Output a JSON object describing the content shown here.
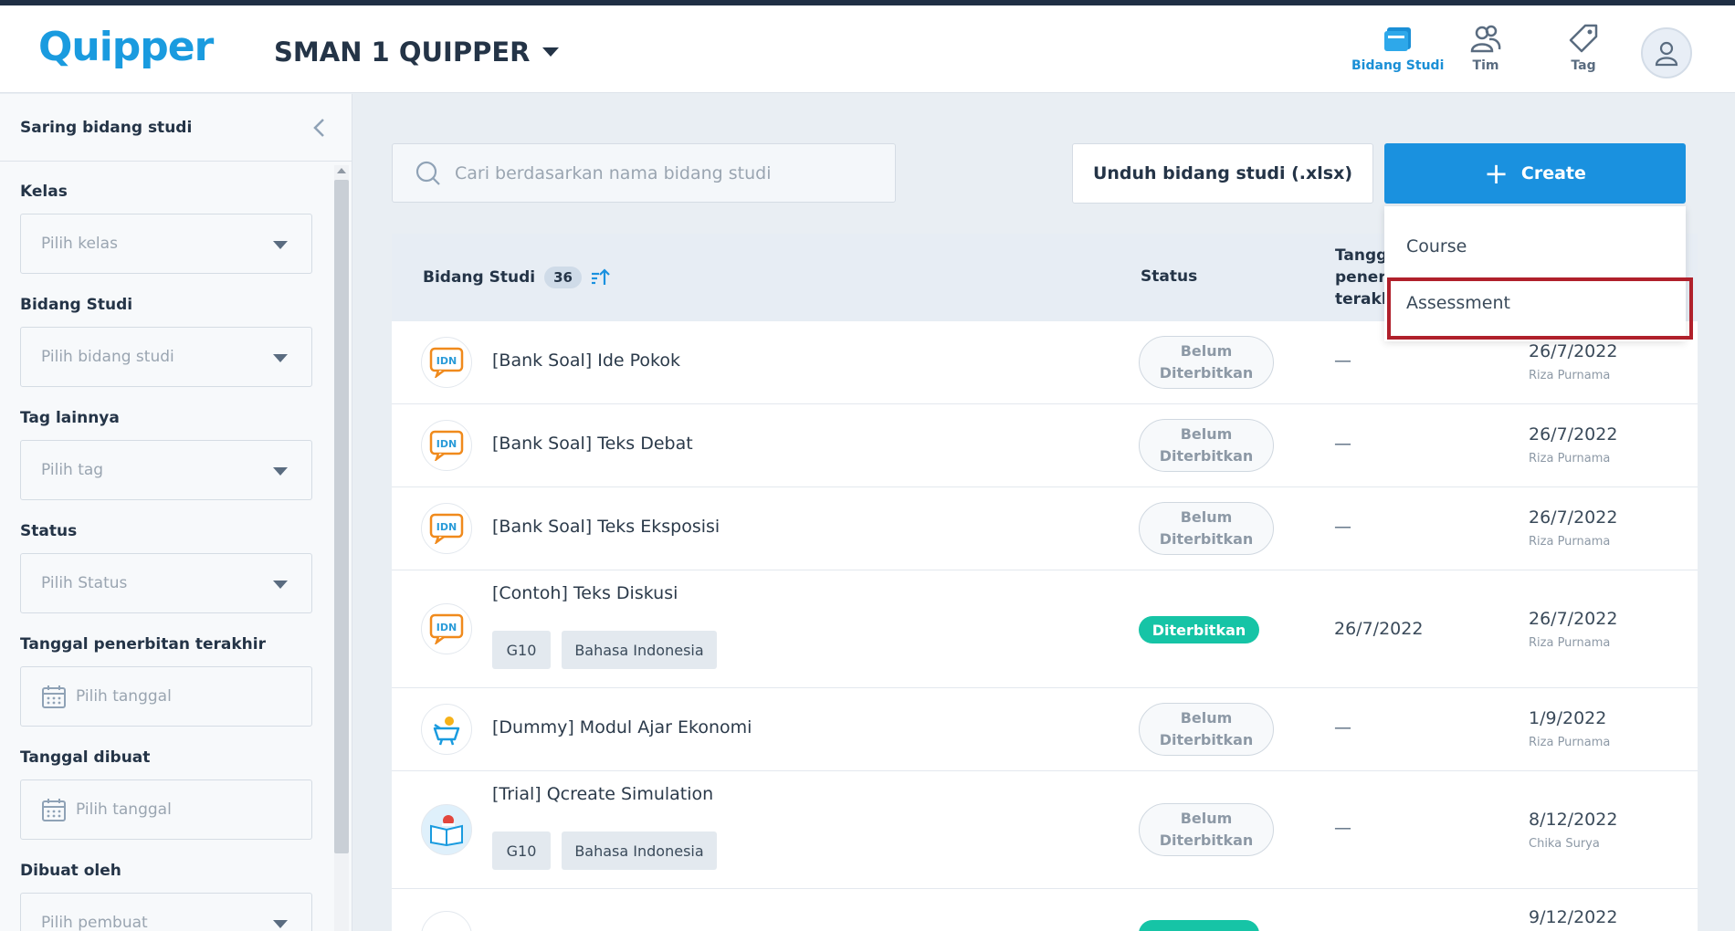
{
  "app": {
    "logo": "Quipper",
    "school": "SMAN 1 QUIPPER"
  },
  "nav": {
    "subjects": "Bidang Studi",
    "team": "Tim",
    "tag": "Tag"
  },
  "sidebar": {
    "title": "Saring bidang studi",
    "filters": {
      "kelas": {
        "label": "Kelas",
        "placeholder": "Pilih kelas"
      },
      "bidang": {
        "label": "Bidang Studi",
        "placeholder": "Pilih bidang studi"
      },
      "tag": {
        "label": "Tag lainnya",
        "placeholder": "Pilih tag"
      },
      "status": {
        "label": "Status",
        "placeholder": "Pilih Status"
      },
      "pubdate": {
        "label": "Tanggal penerbitan terakhir",
        "placeholder": "Pilih tanggal"
      },
      "created": {
        "label": "Tanggal dibuat",
        "placeholder": "Pilih tanggal"
      },
      "creator": {
        "label": "Dibuat oleh",
        "placeholder": "Pilih pembuat"
      }
    }
  },
  "toolbar": {
    "search_placeholder": "Cari berdasarkan nama bidang studi",
    "download_label": "Unduh bidang studi (.xlsx)",
    "create_label": "Create"
  },
  "create_menu": {
    "course": "Course",
    "assessment": "Assessment"
  },
  "table": {
    "headers": {
      "subject": "Bidang Studi",
      "count": "36",
      "status": "Status",
      "pub_line1": "Tangga",
      "pub_line2": "penerb",
      "pub_line3": "terakh"
    },
    "rows": [
      {
        "title": "[Bank Soal] Ide Pokok",
        "status_l1": "Belum",
        "status_l2": "Diterbitkan",
        "published": "—",
        "created": "26/7/2022",
        "creator": "Riza Purnama"
      },
      {
        "title": "[Bank Soal] Teks Debat",
        "status_l1": "Belum",
        "status_l2": "Diterbitkan",
        "published": "—",
        "created": "26/7/2022",
        "creator": "Riza Purnama"
      },
      {
        "title": "[Bank Soal] Teks Eksposisi",
        "status_l1": "Belum",
        "status_l2": "Diterbitkan",
        "published": "—",
        "created": "26/7/2022",
        "creator": "Riza Purnama"
      },
      {
        "title": "[Contoh] Teks Diskusi",
        "chip1": "G10",
        "chip2": "Bahasa Indonesia",
        "status": "Diterbitkan",
        "published": "26/7/2022",
        "created": "26/7/2022",
        "creator": "Riza Purnama"
      },
      {
        "title": "[Dummy] Modul Ajar Ekonomi",
        "status_l1": "Belum",
        "status_l2": "Diterbitkan",
        "published": "—",
        "created": "1/9/2022",
        "creator": "Riza Purnama"
      },
      {
        "title": "[Trial] Qcreate Simulation",
        "chip1": "G10",
        "chip2": "Bahasa Indonesia",
        "status_l1": "Belum",
        "status_l2": "Diterbitkan",
        "published": "—",
        "created": "8/12/2022",
        "creator": "Chika Surya"
      },
      {
        "created": "9/12/2022"
      }
    ]
  },
  "colors": {
    "brand": "#1a9bdf",
    "primary_button": "#1a91df",
    "published_badge": "#16c4a6",
    "highlight": "#b0202b"
  }
}
